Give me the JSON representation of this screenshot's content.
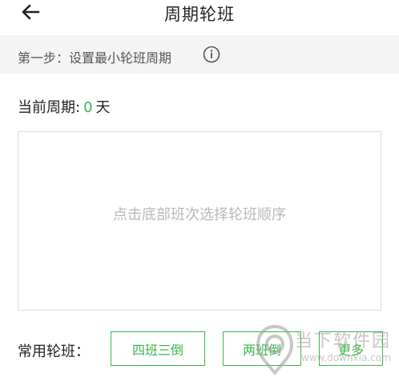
{
  "header": {
    "title": "周期轮班"
  },
  "step": {
    "text": "第一步：设置最小轮班周期"
  },
  "period": {
    "label": "当前周期:",
    "value": "0",
    "unit": "天"
  },
  "sequence": {
    "hint": "点击底部班次选择轮班顺序"
  },
  "common": {
    "label": "常用轮班：",
    "buttons": [
      "四班三倒",
      "两班倒",
      "更多"
    ]
  },
  "watermark": {
    "text": "当下软件园",
    "url": "www.downxia.com"
  },
  "colors": {
    "accent": "#3bb54a",
    "hint": "#b8b8b8",
    "step_bg": "#f4f4f4"
  },
  "icons": {
    "back": "arrow-left-icon",
    "info": "info-circle-icon"
  }
}
